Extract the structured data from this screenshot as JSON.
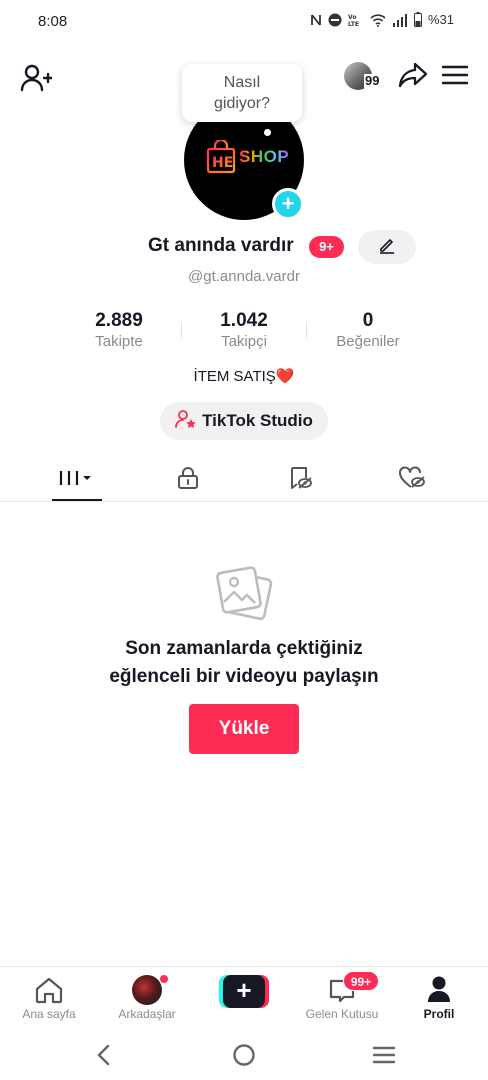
{
  "status_bar": {
    "time": "8:08",
    "battery": "%31",
    "icons": [
      "nfc-icon",
      "dnd-icon",
      "volte-icon",
      "wifi-icon",
      "signal-icon",
      "battery-icon"
    ]
  },
  "top_bar": {
    "story_count": "99",
    "icons": [
      "add-friend-icon",
      "share-icon",
      "menu-icon"
    ]
  },
  "bubble": {
    "text_line1": "Nasıl",
    "text_line2": "gidiyor?"
  },
  "profile": {
    "logo_letters": "HE",
    "logo_text": "SHOP",
    "display_name": "Gt anında vardır",
    "notification_badge": "9+",
    "username": "@gt.annda.vardr",
    "bio": "İTEM SATIŞ❤️"
  },
  "stats": [
    {
      "value": "2.889",
      "label": "Takipte"
    },
    {
      "value": "1.042",
      "label": "Takipçi"
    },
    {
      "value": "0",
      "label": "Beğeniler"
    }
  ],
  "studio_button": {
    "label": "TikTok Studio"
  },
  "tabs": [
    "videos-tab",
    "private-tab",
    "reposts-tab",
    "liked-tab"
  ],
  "empty_state": {
    "line1": "Son zamanlarda çektiğiniz",
    "line2": "eğlenceli bir videoyu paylaşın",
    "button": "Yükle"
  },
  "bottom_nav": {
    "home": "Ana sayfa",
    "friends": "Arkadaşlar",
    "inbox": "Gelen Kutusu",
    "inbox_badge": "99+",
    "profile": "Profil"
  },
  "colors": {
    "accent": "#fe2c55",
    "cyan": "#25f4ee",
    "text": "#161823",
    "muted": "#8a8b91"
  }
}
